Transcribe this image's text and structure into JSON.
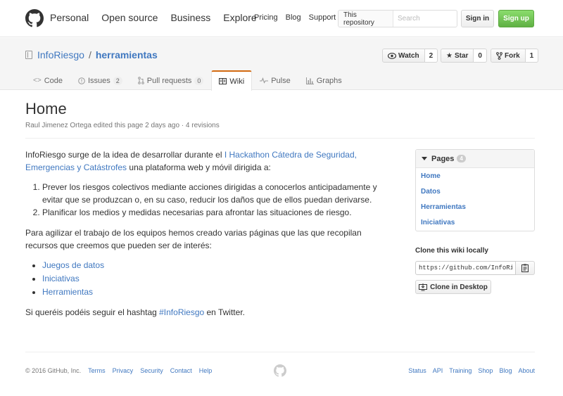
{
  "header": {
    "nav_main": [
      "Personal",
      "Open source",
      "Business",
      "Explore"
    ],
    "nav_sub": [
      "Pricing",
      "Blog",
      "Support"
    ],
    "search_scope": "This repository",
    "search_placeholder": "Search",
    "signin_label": "Sign in",
    "signup_label": "Sign up"
  },
  "repo": {
    "owner": "InfoRiesgo",
    "separator": "/",
    "name": "herramientas",
    "actions": [
      {
        "label": "Watch",
        "icon": "eye-icon",
        "count": "2"
      },
      {
        "label": "Star",
        "icon": "star-icon",
        "count": "0"
      },
      {
        "label": "Fork",
        "icon": "fork-icon",
        "count": "1"
      }
    ],
    "tabs": [
      {
        "label": "Code",
        "icon": "code-icon"
      },
      {
        "label": "Issues",
        "icon": "issue-icon",
        "counter": "2"
      },
      {
        "label": "Pull requests",
        "icon": "pull-request-icon",
        "counter": "0"
      },
      {
        "label": "Wiki",
        "icon": "book-icon",
        "selected": true
      },
      {
        "label": "Pulse",
        "icon": "pulse-icon"
      },
      {
        "label": "Graphs",
        "icon": "graph-icon"
      }
    ]
  },
  "wiki": {
    "title": "Home",
    "meta": "Raul Jimenez Ortega edited this page 2 days ago · 4 revisions",
    "intro_prefix": "InfoRiesgo surge de la idea de desarrollar durante el ",
    "intro_link": "I Hackathon Cátedra de Seguridad, Emergencias y Catástrofes",
    "intro_suffix": " una plataforma web y móvil dirigida a:",
    "goals": [
      "Prever los riesgos colectivos mediante acciones dirigidas a conocerlos anticipadamente y evitar que se produzcan o, en su caso, reducir los daños que de ellos puedan derivarse.",
      "Planificar los medios y medidas necesarias para afrontar las situaciones de riesgo."
    ],
    "para2": "Para agilizar el trabajo de los equipos hemos creado varias páginas que las que recopilan recursos que creemos que pueden ser de interés:",
    "links": [
      "Juegos de datos",
      "Iniciativas",
      "Herramientas"
    ],
    "outro_prefix": "Si queréis podéis seguir el hashtag ",
    "hashtag": "#InfoRiesgo",
    "outro_suffix": " en Twitter."
  },
  "sidebar": {
    "pages_label": "Pages",
    "pages_count": "4",
    "pages": [
      "Home",
      "Datos",
      "Herramientas",
      "Iniciativas"
    ],
    "clone_label": "Clone this wiki locally",
    "clone_url": "https://github.com/InfoRiesgo/herramientas.wiki.git",
    "clone_desktop_label": "Clone in Desktop"
  },
  "footer": {
    "copyright": "© 2016 GitHub, Inc.",
    "left_links": [
      "Terms",
      "Privacy",
      "Security",
      "Contact",
      "Help"
    ],
    "right_links": [
      "Status",
      "API",
      "Training",
      "Shop",
      "Blog",
      "About"
    ]
  },
  "colors": {
    "link": "#4078c0",
    "signup_green": "#60b044",
    "selected_tab_accent": "#d26911"
  }
}
